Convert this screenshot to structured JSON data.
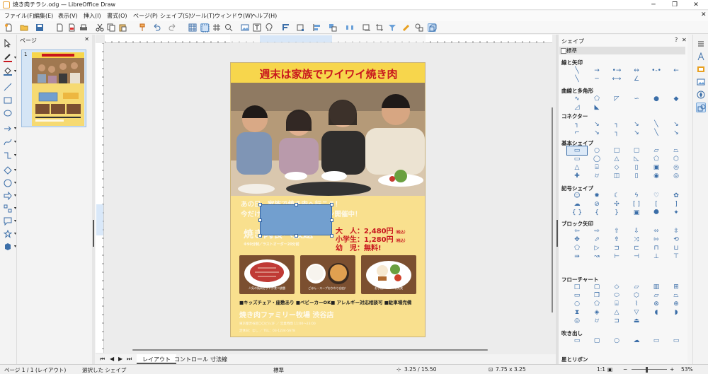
{
  "window": {
    "title": "焼き肉チラシ.odg — LibreOffice Draw"
  },
  "menu": [
    "ファイル(F)",
    "編集(E)",
    "表示(V)",
    "挿入(I)",
    "書式(O)",
    "ページ(P)",
    "シェイプ(S)",
    "ツール(T)",
    "ウィンドウ(W)",
    "ヘルプ(H)"
  ],
  "pages_panel": {
    "title": "ページ",
    "page_number": "1"
  },
  "flyer": {
    "headline": "週末は家族でワイワイ焼き肉",
    "line1": "あの日、家族で焼き肉へ行こう！",
    "line2": "今だけ　　　　　キャンペーン開催中！",
    "big": "焼き肉食べ放題",
    "sub": "※90分制／ラストオーダー20分前",
    "adult": "大　人：2,480円",
    "child": "小学生：1,280円",
    "infant": "幼　児：無料!",
    "tax": "（税込）",
    "food_captions": [
      "人気の焼肉セットが食べ放題",
      "ごはん・スープおかわり自由！",
      "お子様メニューも充実"
    ],
    "features": "■キッズチェア・座敷あり ■ベビーカーOK■ アレルギー対応相談可 ■駐車場完備",
    "restaurant": "焼き肉ファミリー牧場 渋谷店",
    "address": "東京都渋谷区〇〇ビル1F ／ 営業時間 11:00〜23:00",
    "contact": "定休日：なし ／ TEL：03-1234-5678"
  },
  "tabs": [
    "レイアウト",
    "コントロール",
    "寸法線"
  ],
  "shapes_panel": {
    "title": "シェイプ",
    "section": "標準",
    "categories": [
      "線と矢印",
      "曲線と多角形",
      "コネクター",
      "基本シェイプ",
      "記号シェイプ",
      "ブロック矢印",
      "フローチャート",
      "吹き出し",
      "星とリボン"
    ]
  },
  "status": {
    "page": "ページ 1 / 1 (レイアウト)",
    "selection": "選択した シェイプ",
    "style": "標準",
    "position": "3.25 / 15.50",
    "size": "7.75 x 3.25",
    "scale": "1:1",
    "zoom": "53%"
  },
  "colors": {
    "accent": "#3b6ea8",
    "flyer_bg": "#f9e08e",
    "headline": "#c8161d"
  }
}
